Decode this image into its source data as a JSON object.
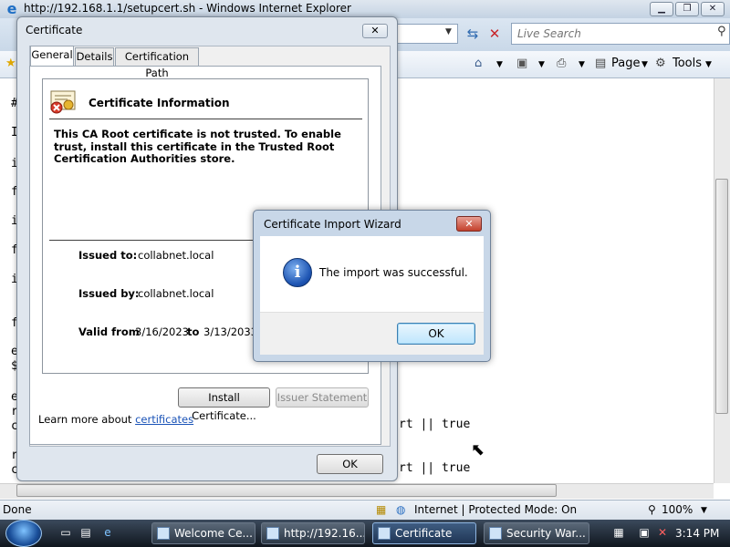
{
  "browser": {
    "title": "http://192.168.1.1/setupcert.sh - Windows Internet Explorer",
    "search_placeholder": "Live Search",
    "commands": {
      "page": "Page",
      "tools": "Tools"
    },
    "status_text": "Done",
    "zone_text": "Internet | Protected Mode: On",
    "zoom": "100%"
  },
  "page_content": {
    "left_chars": [
      "#",
      "I",
      "i",
      "f",
      "i",
      "f",
      "i",
      "f",
      "e",
      "$",
      "e",
      "r",
      "c",
      "r",
      "c"
    ],
    "right_lines": [
      "rt || true",
      "rt || true"
    ]
  },
  "certificate_dialog": {
    "title": "Certificate",
    "tabs": [
      "General",
      "Details",
      "Certification Path"
    ],
    "info_title": "Certificate Information",
    "warning": "This CA Root certificate is not trusted. To enable trust, install this certificate in the Trusted Root Certification Authorities store.",
    "issued_to_label": "Issued to:",
    "issued_to_value": "collabnet.local",
    "issued_by_label": "Issued by:",
    "issued_by_value": "collabnet.local",
    "valid_from_label": "Valid from",
    "valid_from_value": "3/16/2023",
    "valid_to_label": "to",
    "valid_to_value": "3/13/2033",
    "install_button": "Install Certificate...",
    "issuer_button": "Issuer Statement",
    "learn_more_prefix": "Learn more about",
    "learn_more_link": "certificates",
    "ok_button": "OK"
  },
  "import_wizard": {
    "title": "Certificate Import Wizard",
    "message": "The import was successful.",
    "ok_button": "OK"
  },
  "taskbar": {
    "buttons": [
      "Welcome Ce...",
      "http://192.16...",
      "Certificate",
      "Security War..."
    ],
    "clock": "3:14 PM"
  }
}
